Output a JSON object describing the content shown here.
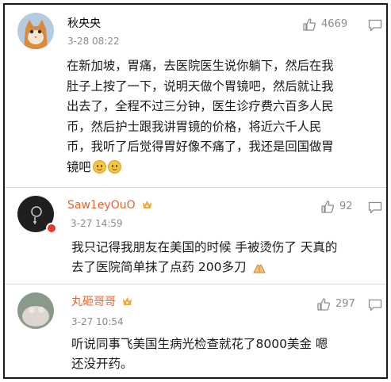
{
  "comments": [
    {
      "user": "秋央央",
      "time": "3-28 08:22",
      "likes": "4669",
      "text_lines": [
        "在新加坡，胃痛，去医院医生说你躺下，然后在我",
        "肚子上按了一下，说明天做个胃镜吧，然后就让我",
        "出去了，全程不过三分钟，医生诊疗费六百多人民",
        "币，然后护士跟我讲胃镜的价格，将近六千人民",
        "币，我听了后觉得胃好像不痛了，我还是回国做胃",
        "镜吧"
      ],
      "name_color": "#1a1a1a"
    },
    {
      "user": "Saw1eyOuO",
      "time": "3-27 14:59",
      "likes": "92",
      "text_lines": [
        "我只记得我朋友在美国的时候 手被烫伤了 天真的",
        "去了医院简单抹了点药 200多刀"
      ],
      "name_color": "#e8632c"
    },
    {
      "user": "丸砸哥哥",
      "time": "3-27 10:54",
      "likes": "297",
      "text_lines": [
        "听说同事飞美国生病光检查就花了8000美金 嗯",
        "还没开药。"
      ],
      "name_color": "#e8632c"
    }
  ],
  "icons": {
    "like": "thumbs-up-icon",
    "reply": "comment-icon",
    "vip": "vip-badge-icon",
    "smile": "smile-emoji-icon",
    "clap": "praying-hands-emoji-icon"
  }
}
